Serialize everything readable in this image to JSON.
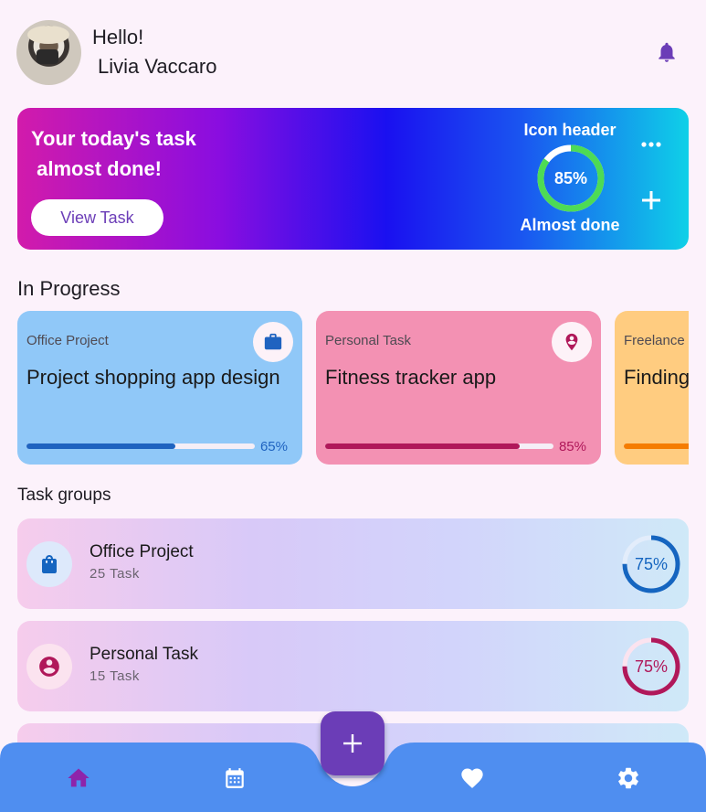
{
  "header": {
    "greeting": "Hello!",
    "username": "Livia Vaccaro",
    "avatar_icon": "user-photo",
    "notification_icon": "bell-icon"
  },
  "banner": {
    "title": "Your today's task\n almost done!",
    "button_label": "View Task",
    "ring_header": "Icon header",
    "ring_percent_label": "85%",
    "ring_percent": 85,
    "ring_footer": "Almost done",
    "more_icon": "more-horiz-icon",
    "add_icon": "plus-icon",
    "ring_color": "#4ddb55"
  },
  "in_progress": {
    "title": "In Progress",
    "cards": [
      {
        "category": "Office Project",
        "title": "Project shopping app design",
        "percent_label": "65%",
        "progress": 0.65,
        "icon": "briefcase-icon",
        "bg": "#90c8f8",
        "accent": "#1f63c0"
      },
      {
        "category": "Personal Task",
        "title": "Fitness tracker app",
        "percent_label": "85%",
        "progress": 0.85,
        "icon": "person-pin-icon",
        "bg": "#f391b3",
        "accent": "#b0185a"
      },
      {
        "category": "Freelance Work",
        "title": "Finding work",
        "percent_label": "",
        "progress": 0.5,
        "icon": "work-icon",
        "bg": "#ffcc80",
        "accent": "#f57c00"
      }
    ]
  },
  "task_groups": {
    "title": "Task groups",
    "groups": [
      {
        "name": "Office Project",
        "count": "25 Task",
        "percent_label": "75%",
        "progress": 0.75,
        "icon": "shopping-bag-icon",
        "accent": "#1565c0",
        "icon_bg": "#dde9fb"
      },
      {
        "name": "Personal Task",
        "count": "15 Task",
        "percent_label": "75%",
        "progress": 0.75,
        "icon": "account-circle-icon",
        "accent": "#b0185a",
        "icon_bg": "#fbe3ef"
      }
    ]
  },
  "nav": {
    "items": [
      "home-icon",
      "calendar-icon",
      "heart-icon",
      "settings-icon"
    ],
    "fab_icon": "plus-icon",
    "bg": "#4f8ef0",
    "active": "#8e24aa"
  }
}
